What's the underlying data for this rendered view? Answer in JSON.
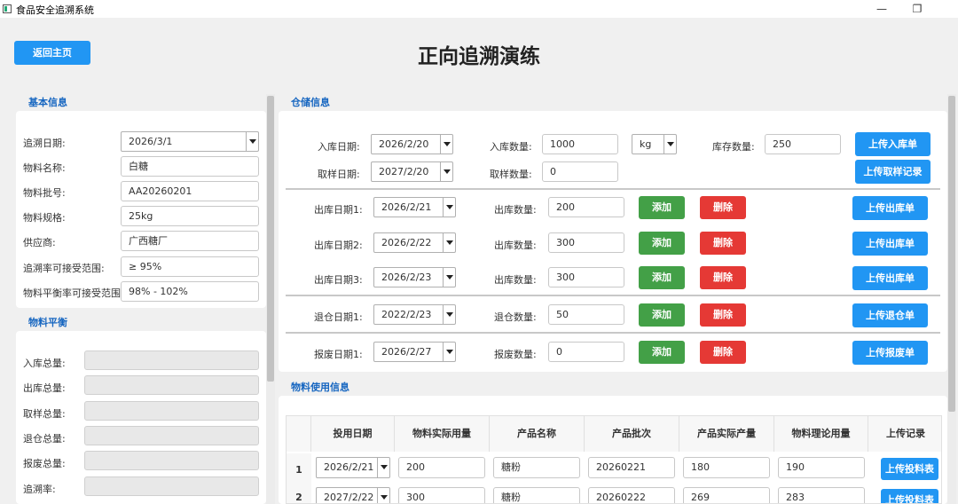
{
  "window": {
    "title": "食品安全追溯系统",
    "min": "—",
    "restore": "❐",
    "close": "✕"
  },
  "header": {
    "back": "返回主页",
    "title": "正向追溯演练"
  },
  "basic": {
    "heading": "基本信息",
    "fields": [
      {
        "label": "追溯日期:",
        "value": "2026/3/1"
      },
      {
        "label": "物料名称:",
        "value": "白糖"
      },
      {
        "label": "物料批号:",
        "value": "AA20260201"
      },
      {
        "label": "物料规格:",
        "value": "25kg"
      },
      {
        "label": "供应商:",
        "value": "广西糖厂"
      },
      {
        "label": "追溯率可接受范围:",
        "value": "≥ 95%"
      },
      {
        "label": "物料平衡率可接受范围:",
        "value": "98% - 102%"
      }
    ]
  },
  "balance": {
    "heading": "物料平衡",
    "labels": [
      "入库总量:",
      "出库总量:",
      "取样总量:",
      "退仓总量:",
      "报废总量:",
      "追溯率:"
    ]
  },
  "storage": {
    "heading": "仓储信息",
    "in_date_label": "入库日期:",
    "in_date": "2026/2/20",
    "in_qty_label": "入库数量:",
    "in_qty": "1000",
    "unit": "kg",
    "stock_label": "库存数量:",
    "stock": "250",
    "upload_in": "上传入库单",
    "sample_date_label": "取样日期:",
    "sample_date": "2027/2/20",
    "sample_qty_label": "取样数量:",
    "sample_qty": "0",
    "upload_sample": "上传取样记录",
    "outs": [
      {
        "date_label": "出库日期1:",
        "date": "2026/2/21",
        "qty_label": "出库数量:",
        "qty": "200"
      },
      {
        "date_label": "出库日期2:",
        "date": "2026/2/22",
        "qty_label": "出库数量:",
        "qty": "300"
      },
      {
        "date_label": "出库日期3:",
        "date": "2026/2/23",
        "qty_label": "出库数量:",
        "qty": "300"
      }
    ],
    "add": "添加",
    "del": "删除",
    "upload_out": "上传出库单",
    "ret": {
      "date_label": "退仓日期1:",
      "date": "2022/2/23",
      "qty_label": "退仓数量:",
      "qty": "50",
      "upload": "上传退仓单"
    },
    "scrap": {
      "date_label": "报废日期1:",
      "date": "2026/2/27",
      "qty_label": "报废数量:",
      "qty": "0",
      "upload": "上传报废单"
    }
  },
  "usage": {
    "heading": "物料使用信息",
    "columns": [
      "投用日期",
      "物料实际用量",
      "产品名称",
      "产品批次",
      "产品实际产量",
      "物料理论用量",
      "上传记录"
    ],
    "rows": [
      {
        "num": "1",
        "date": "2026/2/21",
        "actual": "200",
        "product": "糖粉",
        "batch": "20260221",
        "output": "180",
        "theory": "190",
        "upload": "上传投料表"
      },
      {
        "num": "2",
        "date": "2027/2/22",
        "actual": "300",
        "product": "糖粉",
        "batch": "20260222",
        "output": "269",
        "theory": "283",
        "upload": "上传投料表"
      }
    ]
  }
}
